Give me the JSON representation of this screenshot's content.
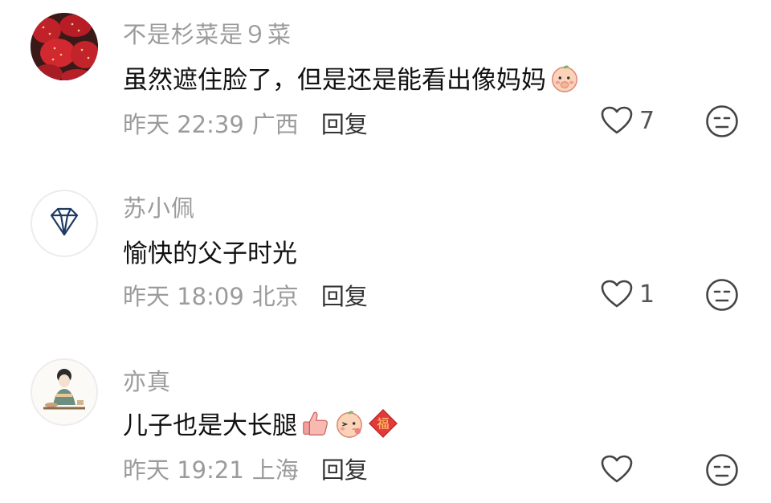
{
  "comments": [
    {
      "username": "不是杉菜是９菜",
      "text": "虽然遮住脸了，但是还是能看出像妈妈",
      "emojis": [
        "peach-blush-face-emoji"
      ],
      "time": "昨天 22:39",
      "location": "广西",
      "reply_label": "回复",
      "likes": "7",
      "avatar": "strawberry-avatar"
    },
    {
      "username": "苏小佩",
      "text": "愉快的父子时光",
      "emojis": [],
      "time": "昨天 18:09",
      "location": "北京",
      "reply_label": "回复",
      "likes": "1",
      "avatar": "diamond-avatar"
    },
    {
      "username": "亦真",
      "text": "儿子也是大长腿",
      "emojis": [
        "thumbs-up-emoji",
        "peach-wink-emoji",
        "fu-diamond-emoji"
      ],
      "emoji_fu_char": "福",
      "time": "昨天 19:21",
      "location": "上海",
      "reply_label": "回复",
      "likes": "",
      "avatar": "lady-tea-avatar"
    }
  ],
  "colors": {
    "username": "#9b9b9b",
    "text": "#111111",
    "meta": "#9b9b9b",
    "reply": "#333333",
    "icon": "#444444"
  }
}
